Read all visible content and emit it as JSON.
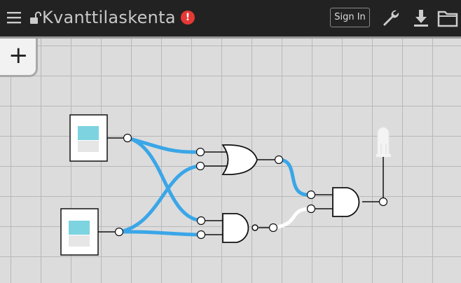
{
  "header": {
    "title": "Kvanttilaskenta",
    "alert_symbol": "!",
    "sign_in_label": "Sign In",
    "icons": [
      "menu-icon",
      "unlock-icon",
      "alert-icon",
      "wrench-icon",
      "download-icon",
      "folder-icon"
    ]
  },
  "toolbar": {
    "add_label": "+"
  },
  "circuit": {
    "inputs": [
      {
        "name": "switch-input-a",
        "state": "on"
      },
      {
        "name": "switch-input-b",
        "state": "on"
      }
    ],
    "gates": [
      {
        "name": "or-gate",
        "type": "OR"
      },
      {
        "name": "nand-gate",
        "type": "NAND"
      },
      {
        "name": "and-gate",
        "type": "AND"
      }
    ],
    "outputs": [
      {
        "name": "led-output",
        "state": "off"
      }
    ]
  },
  "colors": {
    "active_wire": "#3aa6e8",
    "inactive_wire": "#ffffff",
    "topbar": "#222222",
    "canvas": "#dcdcdc",
    "switch_light": "#7dd3e0",
    "alert": "#e53935"
  }
}
